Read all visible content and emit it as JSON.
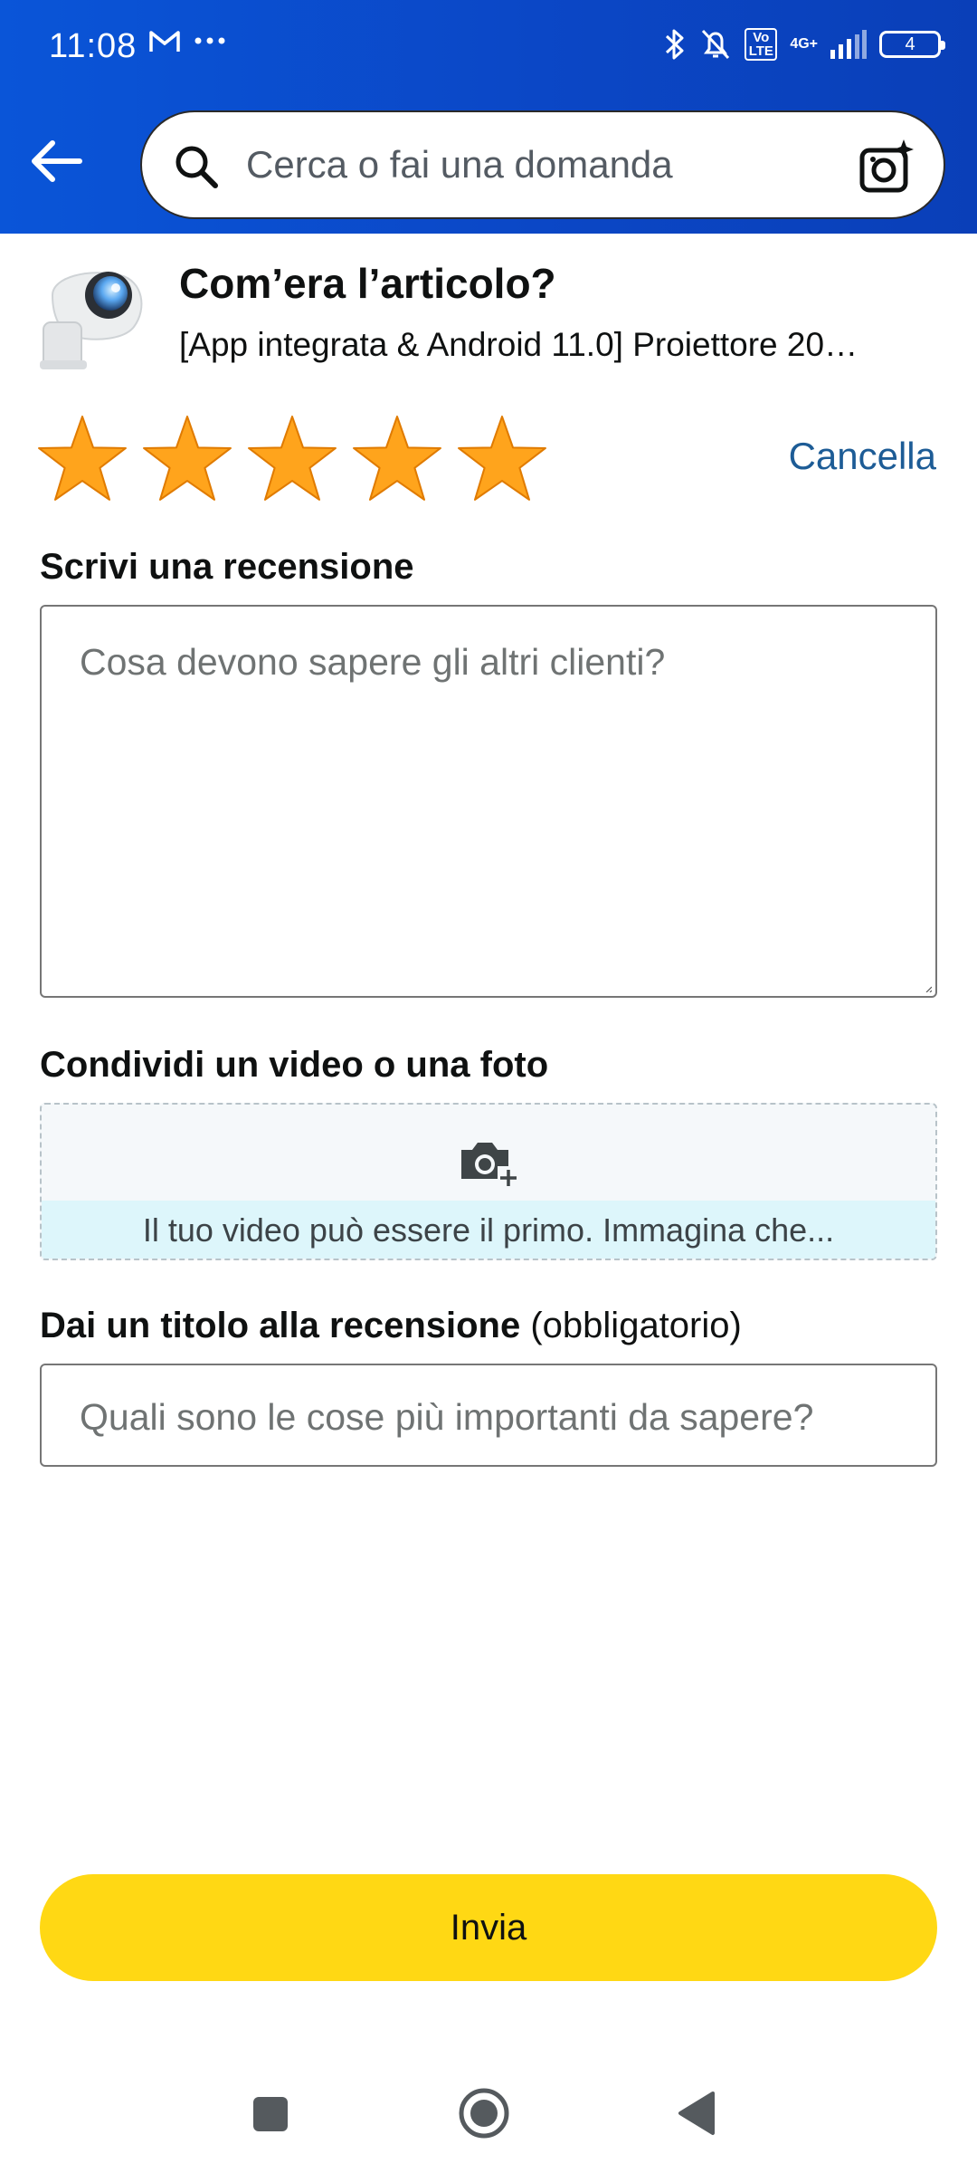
{
  "status_bar": {
    "time": "11:08",
    "left_icons": [
      "gmail-icon",
      "more-dots-icon"
    ],
    "right_icons": [
      "bluetooth-icon",
      "bell-muted-icon",
      "volte-icon",
      "signal-icon",
      "battery-icon"
    ],
    "volte": "Vo LTE",
    "network": "4G+",
    "battery": "4"
  },
  "header": {
    "search_placeholder": "Cerca o fai una domanda",
    "brand_color": "#0b4ed0"
  },
  "product": {
    "heading": "Com’era l’articolo?",
    "name": "[App integrata & Android 11.0] Proiettore 20…"
  },
  "rating": {
    "stars_filled": 5,
    "stars_total": 5,
    "star_color": "#ffa41c",
    "clear_label": "Cancella"
  },
  "review": {
    "label": "Scrivi una recensione",
    "placeholder": "Cosa devono sapere gli altri clienti?"
  },
  "media": {
    "label": "Condividi un video o una foto",
    "hint": "Il tuo video può essere il primo. Immagina che..."
  },
  "review_title": {
    "label": "Dai un titolo alla recensione",
    "label_suffix": "(obbligatorio)",
    "placeholder": "Quali sono le cose più importanti da sapere?"
  },
  "submit": {
    "label": "Invia",
    "color": "#ffd814"
  },
  "nav": [
    "recents-icon",
    "home-icon",
    "back-icon"
  ]
}
